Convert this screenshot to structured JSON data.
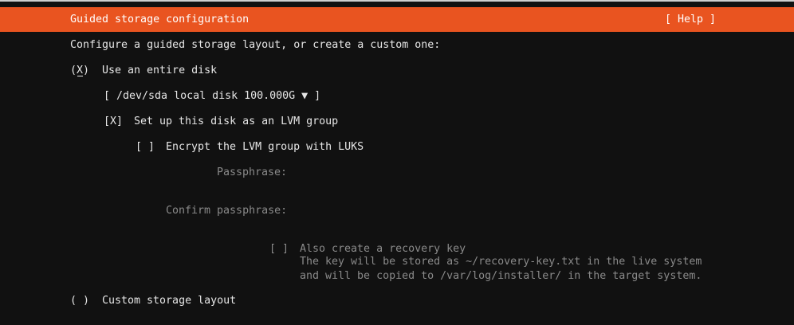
{
  "header": {
    "title": "Guided storage configuration",
    "help_label": "[ Help ]"
  },
  "colors": {
    "accent": "#E95420",
    "background": "#111111",
    "text": "#e6e6e6",
    "disabled": "#8a8a8a"
  },
  "intro": "Configure a guided storage layout, or create a custom one:",
  "entire_disk": {
    "mark": "(X)",
    "label": "Use an entire disk",
    "selected": true
  },
  "disk_select": {
    "value": "[ /dev/sda local disk 100.000G ▼ ]"
  },
  "lvm": {
    "mark": "[X]",
    "label": "Set up this disk as an LVM group",
    "checked": true
  },
  "luks": {
    "mark": "[ ]",
    "label": "Encrypt the LVM group with LUKS",
    "checked": false
  },
  "passphrase": {
    "label": "Passphrase:",
    "value": ""
  },
  "confirm_passphrase": {
    "label": "Confirm passphrase:",
    "value": ""
  },
  "recovery": {
    "mark": "[ ]",
    "label": "Also create a recovery key",
    "line1": "The key will be stored as ~/recovery-key.txt in the live system",
    "line2": "and will be copied to /var/log/installer/ in the target system.",
    "checked": false
  },
  "custom": {
    "mark": "( )",
    "label": "Custom storage layout",
    "selected": false
  }
}
